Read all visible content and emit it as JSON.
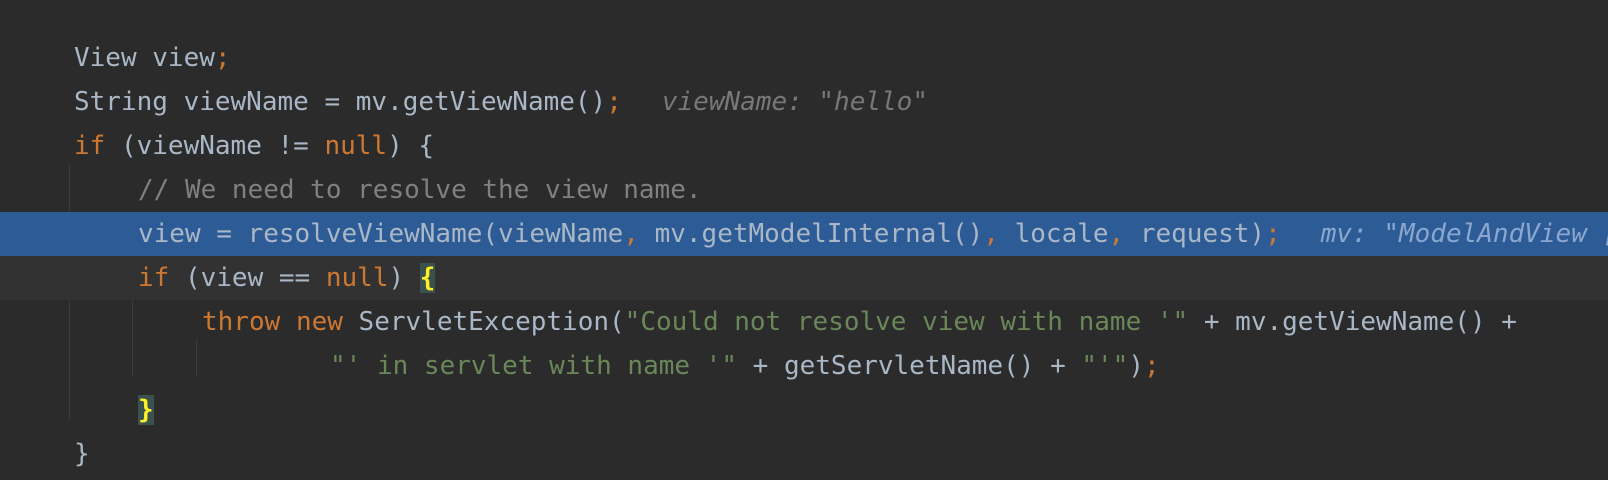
{
  "editor": {
    "lines": [
      {
        "t1": "View view",
        "p1": ";"
      },
      {
        "t1": "String viewName = mv.getViewName()",
        "p1": ";",
        "hint": "viewName: \"hello\""
      },
      {
        "kw1": "if",
        "t1": " (viewName != ",
        "kw2": "null",
        "t2": ") {"
      },
      {
        "cmt": "// We need to resolve the view name."
      },
      {
        "t1": "view = resolveViewName(viewName",
        "p1": ",",
        "t2": " mv.getModelInternal()",
        "p2": ",",
        "t3": " locale",
        "p3": ",",
        "t4": " request)",
        "p4": ";",
        "hint": "mv: \"ModelAndView [view=\\\"hello\\\"; model={}]\""
      },
      {
        "kw1": "if",
        "t1": " (view == ",
        "kw2": "null",
        "t2": ") ",
        "brace": "{"
      },
      {
        "kw1": "throw",
        "kw2": "new",
        "t1": " ServletException(",
        "s1": "\"Could not resolve view with name '\"",
        "t2": " + mv.getViewName() +"
      },
      {
        "s1": "\"' in servlet with name '\"",
        "t1": " + getServletName() + ",
        "s2": "\"'\"",
        "t2": ")",
        "p1": ";"
      },
      {
        "brace": "}"
      },
      {
        "t1": "}"
      }
    ]
  },
  "colors": {
    "background": "#2b2b2b",
    "selection": "#2d5b96",
    "keyword": "#cc7832",
    "string": "#6a8759",
    "comment": "#808080",
    "text": "#a9b7c6",
    "brace_match": "#ffef28"
  }
}
